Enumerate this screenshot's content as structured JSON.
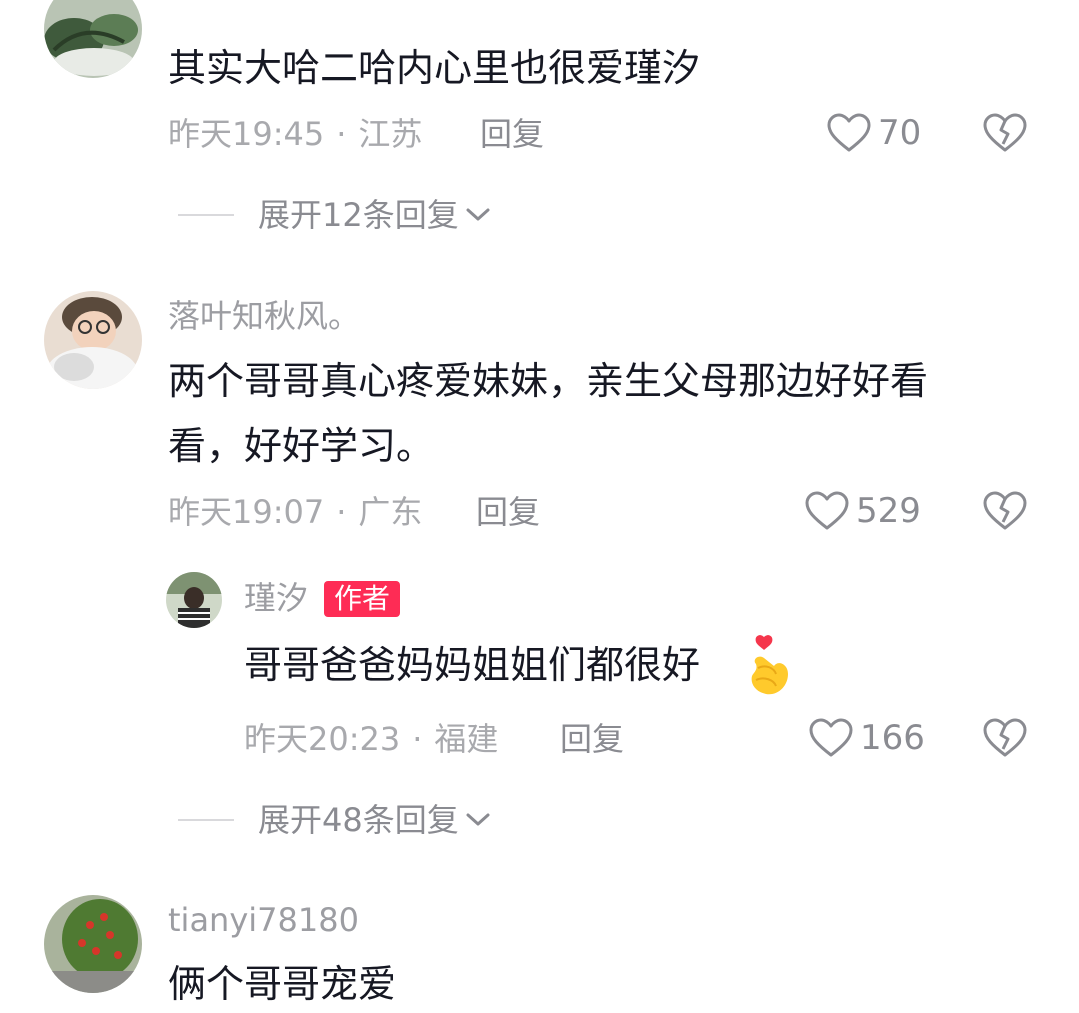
{
  "comments": [
    {
      "content": "其实大哈二哈内心里也很爱瑾汐",
      "time": "昨天19:45",
      "location": "江苏",
      "reply_label": "回复",
      "likes": "70",
      "expand_label": "展开12条回复",
      "avatar": "plant-avatar"
    },
    {
      "username": "落叶知秋风。",
      "content_line1": "两个哥哥真心疼爱妹妹，亲生父母那边好好看",
      "content_line2": "看，好好学习。",
      "time": "昨天19:07",
      "location": "广东",
      "reply_label": "回复",
      "likes": "529",
      "avatar": "person-avatar",
      "reply": {
        "username": "瑾汐",
        "author_tag": "作者",
        "content": "哥哥爸爸妈妈姐姐们都很好",
        "emoji": "finger-heart-emoji",
        "time": "昨天20:23",
        "location": "福建",
        "reply_label": "回复",
        "likes": "166",
        "avatar": "girl-avatar"
      },
      "expand_label": "展开48条回复"
    },
    {
      "username": "tianyi78180",
      "content": "俩个哥哥宠爱",
      "avatar": "tree-avatar"
    }
  ],
  "colors": {
    "accent": "#fe2c55",
    "text": "#161823",
    "muted": "#a8a9ad"
  },
  "separator": "·"
}
